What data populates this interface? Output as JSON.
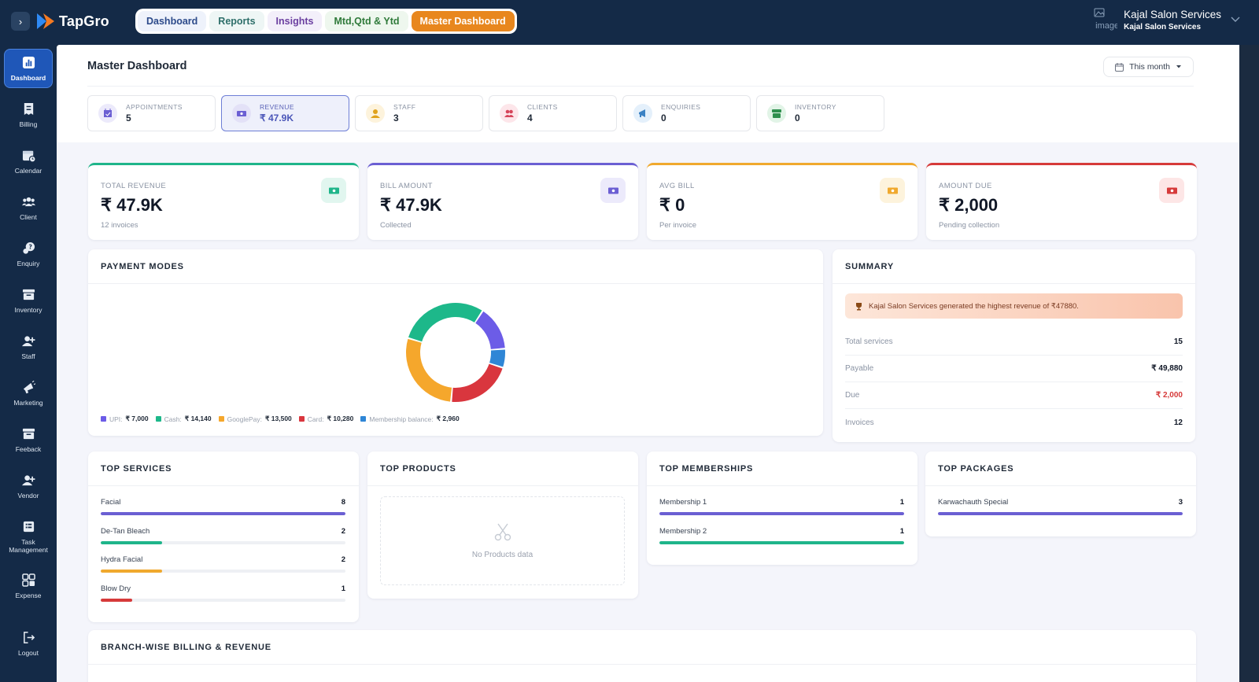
{
  "app": {
    "brand": "TapGro",
    "toggle_glyph": "›"
  },
  "nav": {
    "tabs": [
      {
        "label": "Dashboard"
      },
      {
        "label": "Reports"
      },
      {
        "label": "Insights"
      },
      {
        "label": "Mtd,Qtd & Ytd"
      },
      {
        "label": "Master Dashboard",
        "active": true
      }
    ]
  },
  "user": {
    "name": "Kajal Salon Services",
    "subtitle": "Kajal Salon Services",
    "avatar_alt": "image"
  },
  "sidebar": {
    "items": [
      {
        "label": "Dashboard",
        "icon": "chart-icon",
        "active": true
      },
      {
        "label": "Billing",
        "icon": "receipt-icon"
      },
      {
        "label": "Calendar",
        "icon": "calendar-icon"
      },
      {
        "label": "Client",
        "icon": "users-icon"
      },
      {
        "label": "Enquiry",
        "icon": "chat-icon"
      },
      {
        "label": "Inventory",
        "icon": "archive-icon"
      },
      {
        "label": "Staff",
        "icon": "user-plus-icon"
      },
      {
        "label": "Marketing",
        "icon": "megaphone-icon"
      },
      {
        "label": "Feeback",
        "icon": "archive-icon"
      },
      {
        "label": "Vendor",
        "icon": "user-plus-icon"
      },
      {
        "label": "Task Management",
        "icon": "list-icon"
      },
      {
        "label": "Expense",
        "icon": "grid-icon"
      },
      {
        "label": "Logout",
        "icon": "logout-icon"
      }
    ]
  },
  "page": {
    "title": "Master Dashboard",
    "period": "This month"
  },
  "kpi_tabs": [
    {
      "label": "APPOINTMENTS",
      "value": "5",
      "color": "#6b5fd3",
      "bg": "#eceafb"
    },
    {
      "label": "REVENUE",
      "value": "₹ 47.9K",
      "color": "#6b5fd3",
      "bg": "#e3e1f7",
      "selected": true
    },
    {
      "label": "STAFF",
      "value": "3",
      "color": "#e0a21b",
      "bg": "#fdf3dc"
    },
    {
      "label": "CLIENTS",
      "value": "4",
      "color": "#d6455a",
      "bg": "#fde6ea"
    },
    {
      "label": "ENQUIRIES",
      "value": "0",
      "color": "#3b82c4",
      "bg": "#e4f0fb"
    },
    {
      "label": "INVENTORY",
      "value": "0",
      "color": "#2f8f4e",
      "bg": "#e2f4e7"
    }
  ],
  "stats": [
    {
      "label": "TOTAL REVENUE",
      "value": "₹ 47.9K",
      "sub": "12 invoices",
      "color": "#1fb58a",
      "icon_bg": "#e1f6ef"
    },
    {
      "label": "BILL AMOUNT",
      "value": "₹ 47.9K",
      "sub": "Collected",
      "color": "#6b5fd3",
      "icon_bg": "#eceafb"
    },
    {
      "label": "AVG BILL",
      "value": "₹ 0",
      "sub": "Per invoice",
      "color": "#f0a92e",
      "icon_bg": "#fdf3dc"
    },
    {
      "label": "AMOUNT DUE",
      "value": "₹ 2,000",
      "sub": "Pending collection",
      "color": "#d63a3a",
      "icon_bg": "#fde6e6"
    }
  ],
  "payment_modes": {
    "title": "PAYMENT MODES",
    "items": [
      {
        "label": "UPI:",
        "display": "₹ 7,000",
        "value": 7000,
        "color": "#6c5ce7"
      },
      {
        "label": "Cash:",
        "display": "₹ 14,140",
        "value": 14140,
        "color": "#1db88a"
      },
      {
        "label": "GooglePay:",
        "display": "₹ 13,500",
        "value": 13500,
        "color": "#f5a72c"
      },
      {
        "label": "Card:",
        "display": "₹ 10,280",
        "value": 10280,
        "color": "#d9363e"
      },
      {
        "label": "Membership balance:",
        "display": "₹ 2,960",
        "value": 2960,
        "color": "#2f86d6"
      }
    ],
    "draw_order": [
      1,
      0,
      4,
      3,
      2
    ]
  },
  "summary": {
    "title": "SUMMARY",
    "banner": "Kajal Salon Services generated the highest revenue of ₹47880.",
    "rows": [
      {
        "key": "Total services",
        "value": "15"
      },
      {
        "key": "Payable",
        "value": "₹ 49,880"
      },
      {
        "key": "Due",
        "value": "₹ 2,000",
        "color": "#d63a3a"
      },
      {
        "key": "Invoices",
        "value": "12"
      }
    ]
  },
  "top_services": {
    "title": "TOP SERVICES",
    "items": [
      {
        "label": "Facial",
        "count": "8",
        "fraction": 1.0,
        "color": "#6b5fd3"
      },
      {
        "label": "De-Tan Bleach",
        "count": "2",
        "fraction": 0.25,
        "color": "#1fb58a"
      },
      {
        "label": "Hydra Facial",
        "count": "2",
        "fraction": 0.25,
        "color": "#f0a92e"
      },
      {
        "label": "Blow Dry",
        "count": "1",
        "fraction": 0.13,
        "color": "#d63a3a"
      }
    ]
  },
  "top_products": {
    "title": "TOP PRODUCTS",
    "empty": "No Products data"
  },
  "top_memberships": {
    "title": "TOP MEMBERSHIPS",
    "items": [
      {
        "label": "Membership 1",
        "count": "1",
        "fraction": 1.0,
        "color": "#6b5fd3"
      },
      {
        "label": "Membership 2",
        "count": "1",
        "fraction": 1.0,
        "color": "#1fb58a"
      }
    ]
  },
  "top_packages": {
    "title": "TOP PACKAGES",
    "items": [
      {
        "label": "Karwachauth Special",
        "count": "3",
        "fraction": 1.0,
        "color": "#6b5fd3"
      }
    ]
  },
  "branch": {
    "title": "BRANCH-WISE BILLING & REVENUE"
  }
}
